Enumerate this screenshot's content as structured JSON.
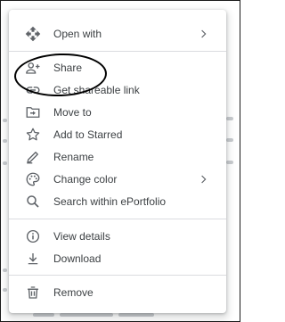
{
  "menu": {
    "items": [
      {
        "label": "Open with",
        "icon": "open-with-icon",
        "submenu": true
      },
      {
        "label": "Share",
        "icon": "person-add-icon",
        "submenu": false
      },
      {
        "label": "Get shareable link",
        "icon": "link-icon",
        "submenu": false
      },
      {
        "label": "Move to",
        "icon": "move-to-folder-icon",
        "submenu": false
      },
      {
        "label": "Add to Starred",
        "icon": "star-icon",
        "submenu": false
      },
      {
        "label": "Rename",
        "icon": "pencil-icon",
        "submenu": false
      },
      {
        "label": "Change color",
        "icon": "palette-icon",
        "submenu": true
      },
      {
        "label": "Search within ePortfolio",
        "icon": "search-icon",
        "submenu": false
      },
      {
        "label": "View details",
        "icon": "info-icon",
        "submenu": false
      },
      {
        "label": "Download",
        "icon": "download-icon",
        "submenu": false
      },
      {
        "label": "Remove",
        "icon": "trash-icon",
        "submenu": false
      }
    ]
  },
  "annotation": {
    "shape": "hand-drawn ellipse",
    "target": "Share",
    "color": "#000000"
  },
  "colors": {
    "icon": "#5f6368",
    "text": "#3c4043",
    "divider": "#dadce0"
  }
}
